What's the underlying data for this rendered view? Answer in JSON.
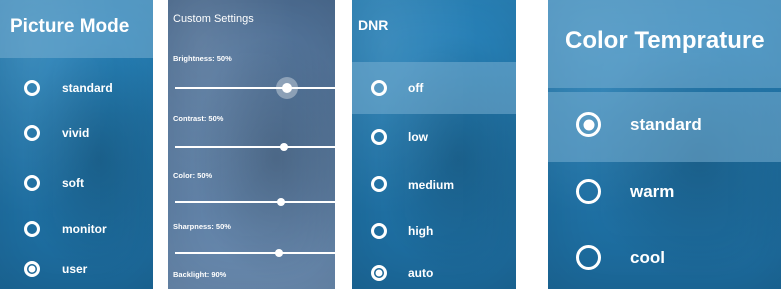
{
  "picture_mode": {
    "title": "Picture Mode",
    "options": [
      {
        "label": "standard",
        "checked": false
      },
      {
        "label": "vivid",
        "checked": false
      },
      {
        "label": "soft",
        "checked": false
      },
      {
        "label": "monitor",
        "checked": false
      },
      {
        "label": "user",
        "checked": true
      }
    ]
  },
  "custom_settings": {
    "title": "Custom Settings",
    "sliders": [
      {
        "label": "Brightness: 50%",
        "value": 50
      },
      {
        "label": "Contrast: 50%",
        "value": 50
      },
      {
        "label": "Color: 50%",
        "value": 50
      },
      {
        "label": "Sharpness: 50%",
        "value": 50
      },
      {
        "label": "Backlight: 90%",
        "value": 90
      }
    ]
  },
  "dnr": {
    "title": "DNR",
    "options": [
      {
        "label": "off",
        "checked": false
      },
      {
        "label": "low",
        "checked": false
      },
      {
        "label": "medium",
        "checked": false
      },
      {
        "label": "high",
        "checked": false
      },
      {
        "label": "auto",
        "checked": true
      }
    ]
  },
  "color_temperature": {
    "title": "Color Temprature",
    "options": [
      {
        "label": "standard",
        "checked": true
      },
      {
        "label": "warm",
        "checked": false
      },
      {
        "label": "cool",
        "checked": false
      }
    ]
  }
}
